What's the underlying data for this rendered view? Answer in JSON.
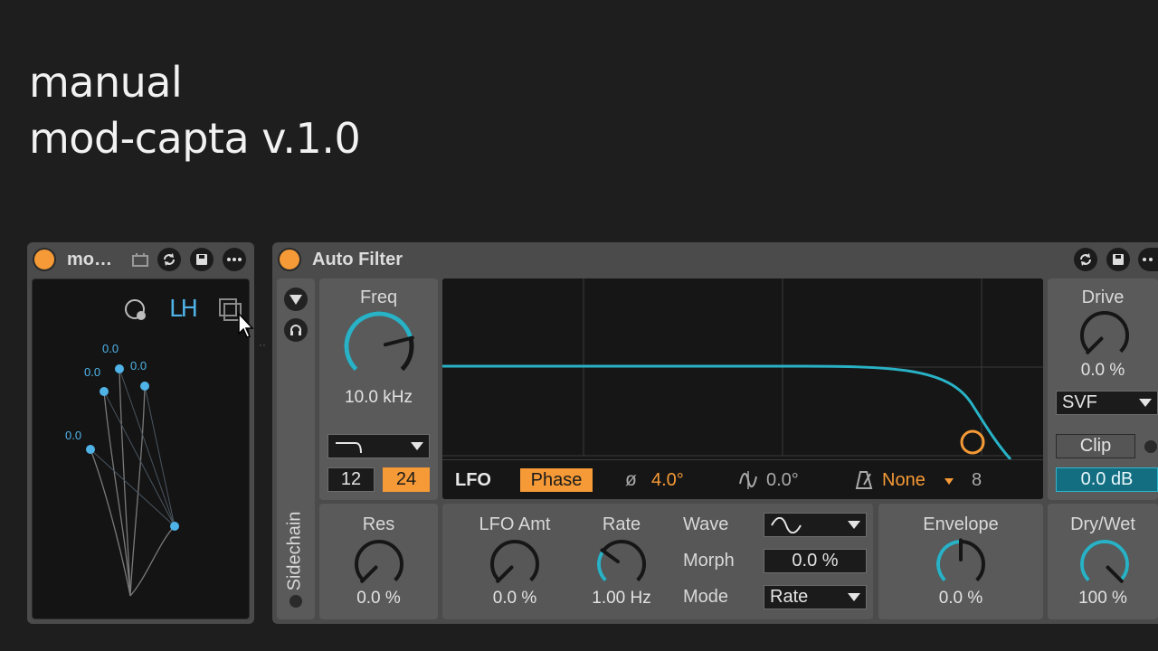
{
  "page": {
    "title_line1": "manual",
    "title_line2": "mod-capta v.1.0"
  },
  "mod_capta": {
    "title": "mo…",
    "toolbar": {
      "mode_label": "LH"
    },
    "node_values": [
      "0.0",
      "0.0",
      "0.0",
      "0.0"
    ],
    "colors": {
      "node": "#4fb3e8",
      "power": "#f59a36"
    }
  },
  "auto_filter": {
    "title": "Auto Filter",
    "sidechain_label": "Sidechain",
    "freq": {
      "label": "Freq",
      "value": "10.0 kHz",
      "level": 0.78
    },
    "filter_type": {
      "selected": "lowpass"
    },
    "slopes": [
      "12",
      "24"
    ],
    "selected_slope": "24",
    "res": {
      "label": "Res",
      "value": "0.0 %",
      "level": 0.0
    },
    "lfo": {
      "label": "LFO",
      "phase_button": "Phase",
      "phase_symbol": "ø",
      "phase_value": "4.0°",
      "offset_value": "0.0°",
      "sync_value": "None",
      "sync_steps": "8"
    },
    "lfo_amt": {
      "label": "LFO Amt",
      "value": "0.0 %",
      "level": 0.0
    },
    "rate": {
      "label": "Rate",
      "value": "1.00 Hz",
      "level": 0.3
    },
    "wave": {
      "label": "Wave"
    },
    "morph": {
      "label": "Morph",
      "value": "0.0 %"
    },
    "mode": {
      "label": "Mode",
      "value": "Rate"
    },
    "envelope": {
      "label": "Envelope",
      "value": "0.0 %",
      "level": 0.5
    },
    "drive": {
      "label": "Drive",
      "value": "0.0 %",
      "level": 0.0
    },
    "circuit": {
      "value": "SVF"
    },
    "clip": {
      "label": "Clip"
    },
    "output_gain": {
      "value": "0.0 dB"
    },
    "dry_wet": {
      "label": "Dry/Wet",
      "value": "100 %",
      "level": 1.0
    },
    "colors": {
      "accent": "#f59a36",
      "curve": "#29b2c6",
      "knob_arc": "#29b2c6"
    }
  }
}
